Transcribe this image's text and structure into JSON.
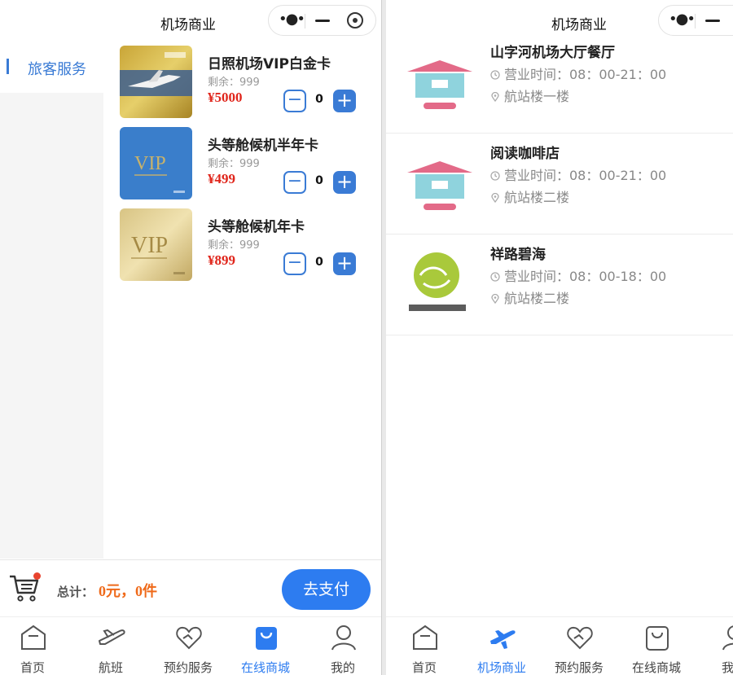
{
  "left_screen": {
    "title": "机场商业",
    "category": "旅客服务",
    "products": [
      {
        "name": "日照机场VIP白金卡",
        "stock": "剩余：999",
        "price": "¥5000",
        "qty": "0"
      },
      {
        "name": "头等舱候机半年卡",
        "stock": "剩余：999",
        "price": "¥499",
        "qty": "0"
      },
      {
        "name": "头等舱候机年卡",
        "stock": "剩余：999",
        "price": "¥899",
        "qty": "0"
      }
    ],
    "cart": {
      "total_label": "总计：",
      "total_value": "0元，0件",
      "pay_label": "去支付"
    },
    "tabs": [
      {
        "label": "首页",
        "icon": "home-icon"
      },
      {
        "label": "航班",
        "icon": "plane-icon"
      },
      {
        "label": "预约服务",
        "icon": "heart-hand-icon"
      },
      {
        "label": "在线商城",
        "icon": "shopping-bag-icon"
      },
      {
        "label": "我的",
        "icon": "user-icon"
      }
    ],
    "active_tab": "在线商城"
  },
  "right_screen": {
    "title": "机场商业",
    "shops": [
      {
        "name": "山字河机场大厅餐厅",
        "hours": "营业时间：08：00-21：00",
        "location": "航站楼一楼"
      },
      {
        "name": "阅读咖啡店",
        "hours": "营业时间：08：00-21：00",
        "location": "航站楼二楼"
      },
      {
        "name": "祥路碧海",
        "hours": "营业时间：08：00-18：00",
        "location": "航站楼二楼"
      }
    ],
    "tabs": [
      {
        "label": "首页",
        "icon": "home-icon"
      },
      {
        "label": "机场商业",
        "icon": "plane-icon"
      },
      {
        "label": "预约服务",
        "icon": "heart-hand-icon"
      },
      {
        "label": "在线商城",
        "icon": "shopping-bag-icon"
      },
      {
        "label": "我的",
        "icon": "user-icon"
      }
    ],
    "active_tab": "机场商业"
  },
  "colors": {
    "accent": "#2d7cf0",
    "price": "#e0251b",
    "total": "#ef6a1a"
  }
}
